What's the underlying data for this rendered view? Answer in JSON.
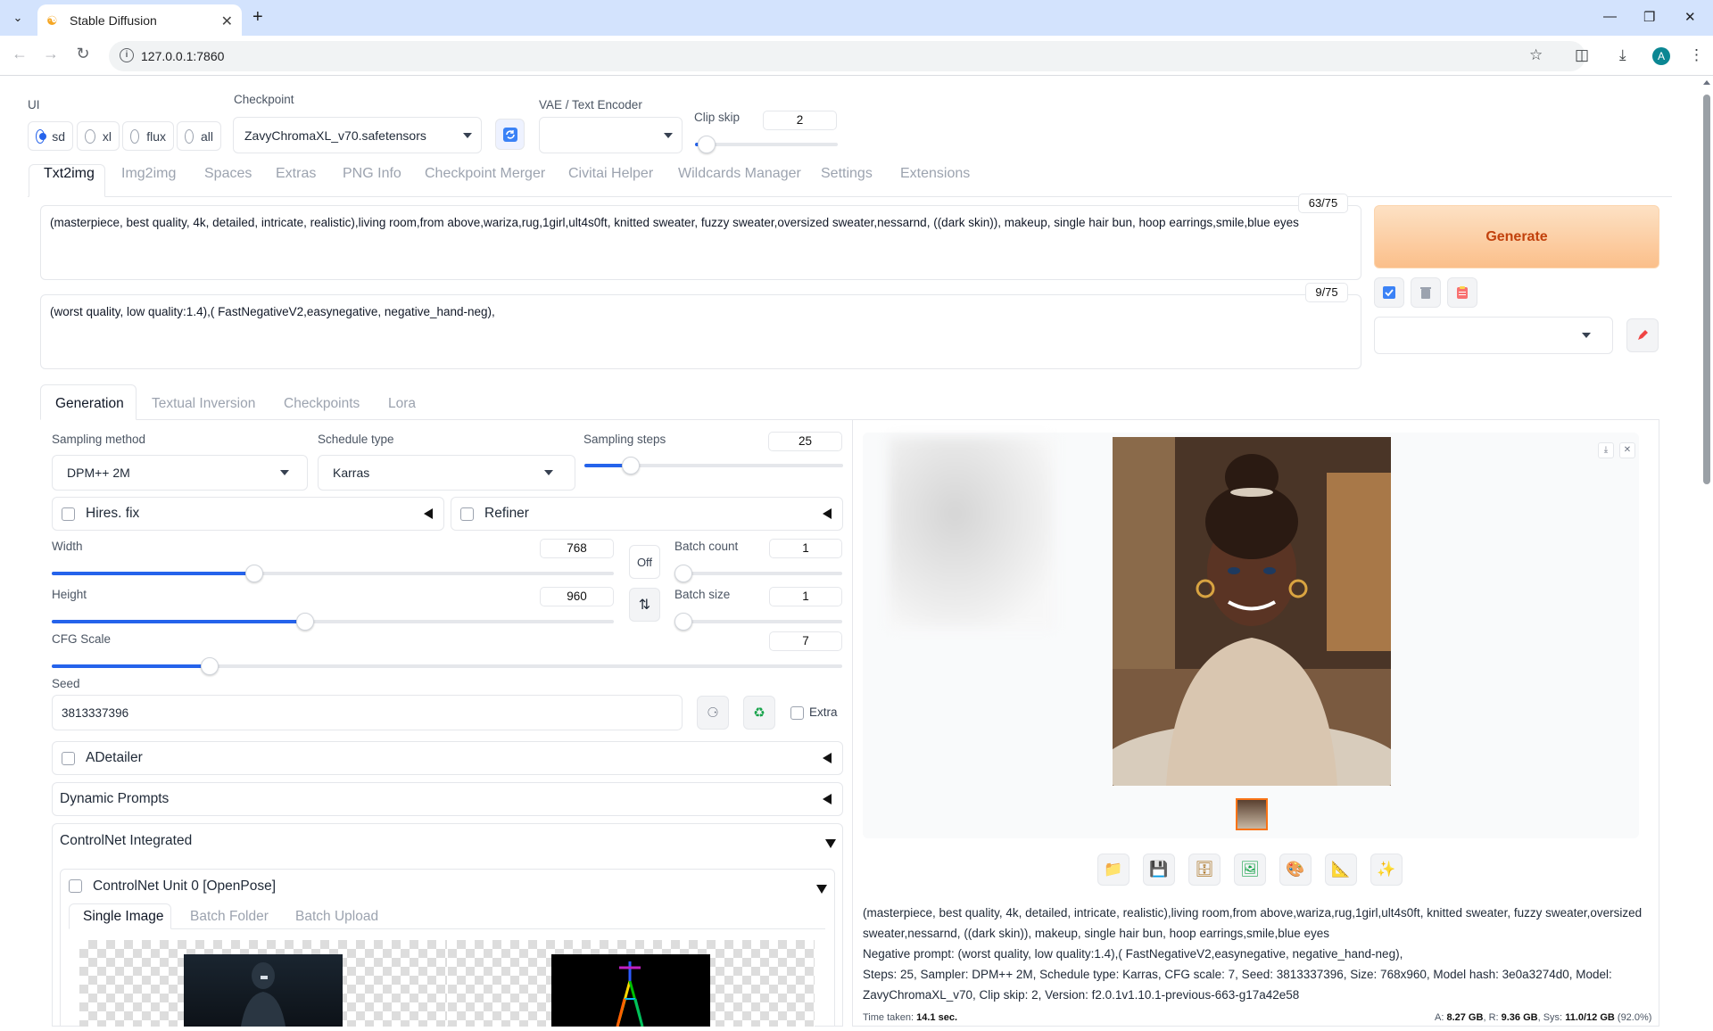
{
  "browser": {
    "tab_title": "Stable Diffusion",
    "url": "127.0.0.1:7860",
    "avatar_letter": "A"
  },
  "top": {
    "ui_label": "UI",
    "ui_options": [
      "sd",
      "xl",
      "flux",
      "all"
    ],
    "ui_selected": "sd",
    "checkpoint_label": "Checkpoint",
    "checkpoint_value": "ZavyChromaXL_v70.safetensors",
    "vae_label": "VAE / Text Encoder",
    "vae_value": "",
    "clip_skip_label": "Clip skip",
    "clip_skip_value": "2"
  },
  "main_tabs": [
    "Txt2img",
    "Img2img",
    "Spaces",
    "Extras",
    "PNG Info",
    "Checkpoint Merger",
    "Civitai Helper",
    "Wildcards Manager",
    "Settings",
    "Extensions"
  ],
  "active_main_tab": "Txt2img",
  "prompt": {
    "positive": "(masterpiece, best quality, 4k, detailed, intricate, realistic),living room,from above,wariza,rug,1girl,ult4s0ft, knitted sweater, fuzzy sweater,oversized sweater,nessarnd, ((dark skin)), makeup, single hair bun, hoop earrings,smile,blue eyes",
    "positive_count": "63/75",
    "negative": "(worst quality, low quality:1.4),( FastNegativeV2,easynegative, negative_hand-neg),",
    "negative_count": "9/75"
  },
  "generate_label": "Generate",
  "sub_tabs": [
    "Generation",
    "Textual Inversion",
    "Checkpoints",
    "Lora"
  ],
  "generation": {
    "sampling_method_label": "Sampling method",
    "sampling_method_value": "DPM++ 2M",
    "schedule_type_label": "Schedule type",
    "schedule_type_value": "Karras",
    "sampling_steps_label": "Sampling steps",
    "sampling_steps_value": "25",
    "hires_fix_label": "Hires. fix",
    "refiner_label": "Refiner",
    "width_label": "Width",
    "width_value": "768",
    "height_label": "Height",
    "height_value": "960",
    "swap_label": "Off",
    "batch_count_label": "Batch count",
    "batch_count_value": "1",
    "batch_size_label": "Batch size",
    "batch_size_value": "1",
    "cfg_label": "CFG Scale",
    "cfg_value": "7",
    "seed_label": "Seed",
    "seed_value": "3813337396",
    "extra_label": "Extra",
    "adetailer_label": "ADetailer",
    "dynamic_prompts_label": "Dynamic Prompts",
    "controlnet_label": "ControlNet Integrated",
    "controlnet_unit_label": "ControlNet Unit 0 [OpenPose]",
    "cn_tabs": [
      "Single Image",
      "Batch Folder",
      "Batch Upload"
    ]
  },
  "sliders": {
    "clip_skip": 0.08,
    "sampling_steps": 0.18,
    "width": 0.36,
    "height": 0.45,
    "batch_count": 0.0,
    "batch_size": 0.0,
    "cfg": 0.2
  },
  "output": {
    "info_positive": "(masterpiece, best quality, 4k, detailed, intricate, realistic),living room,from above,wariza,rug,1girl,ult4s0ft, knitted sweater, fuzzy sweater,oversized sweater,nessarnd, ((dark skin)), makeup, single hair bun, hoop earrings,smile,blue eyes",
    "info_negative": "Negative prompt: (worst quality, low quality:1.4),( FastNegativeV2,easynegative, negative_hand-neg),",
    "info_params": "Steps: 25, Sampler: DPM++ 2M, Schedule type: Karras, CFG scale: 7, Seed: 3813337396, Size: 768x960, Model hash: 3e0a3274d0, Model: ZavyChromaXL_v70, Clip skip: 2, Version: f2.0.1v1.10.1-previous-663-g17a42e58",
    "time_label": "Time taken:",
    "time_value": "14.1 sec.",
    "mem_a_label": "A:",
    "mem_a_value": "8.27 GB",
    "mem_r_label": "R:",
    "mem_r_value": "9.36 GB",
    "mem_sys_label": "Sys:",
    "mem_sys_value": "11.0/12 GB",
    "mem_pct": "(92.0%)"
  },
  "colors": {
    "accent": "#2563eb",
    "generate_bg": "#fcc89a",
    "generate_text": "#c2410c"
  }
}
